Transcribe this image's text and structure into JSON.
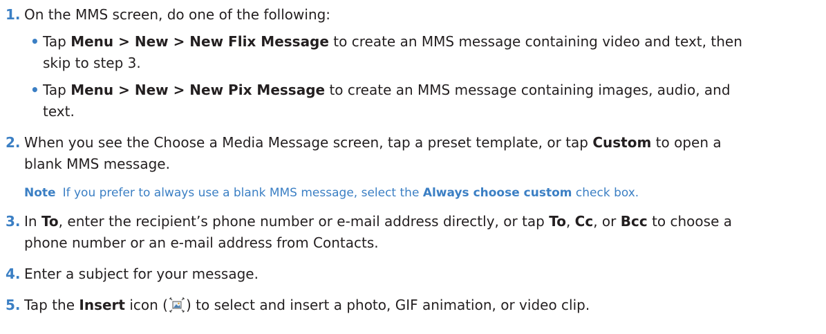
{
  "steps": [
    {
      "num": "1.",
      "text": "On the MMS screen, do one of the following:",
      "bullets": [
        {
          "t1": "Tap ",
          "b1": "Menu > New > New Flix Message",
          "t2": " to create an MMS message containing video and text, then",
          "t3": "skip to step 3."
        },
        {
          "t1": "Tap ",
          "b1": "Menu > New > New Pix Message",
          "t2": " to create an MMS message containing images, audio, and",
          "t3": "text."
        }
      ]
    },
    {
      "num": "2.",
      "t1": "When you see the Choose a Media Message screen, tap a preset template, or tap ",
      "b1": "Custom",
      "t2": " to open a",
      "t3": "blank MMS message."
    },
    {
      "num": "3.",
      "t1": "In ",
      "b1": "To",
      "t2": ", enter the recipient’s phone number or e-mail address directly, or tap ",
      "b2": "To",
      "t3": ", ",
      "b3": "Cc",
      "t4": ", or ",
      "b4": "Bcc",
      "t5": " to choose a",
      "t6": "phone number or an e-mail address from Contacts."
    },
    {
      "num": "4.",
      "text": "Enter a subject for your message."
    },
    {
      "num": "5.",
      "t1": "Tap the ",
      "b1": "Insert",
      "t2": " icon (",
      "t3": ") to select and insert a photo, GIF animation, or video clip."
    }
  ],
  "note": {
    "label": "Note",
    "t1": "If you prefer to always use a blank MMS message, select the ",
    "b1": "Always choose custom",
    "t2": " check box."
  },
  "bullet_glyph": "•",
  "icons": {
    "insert": "insert-media-icon"
  },
  "colors": {
    "accent": "#3b7fc4",
    "text": "#231f20"
  }
}
